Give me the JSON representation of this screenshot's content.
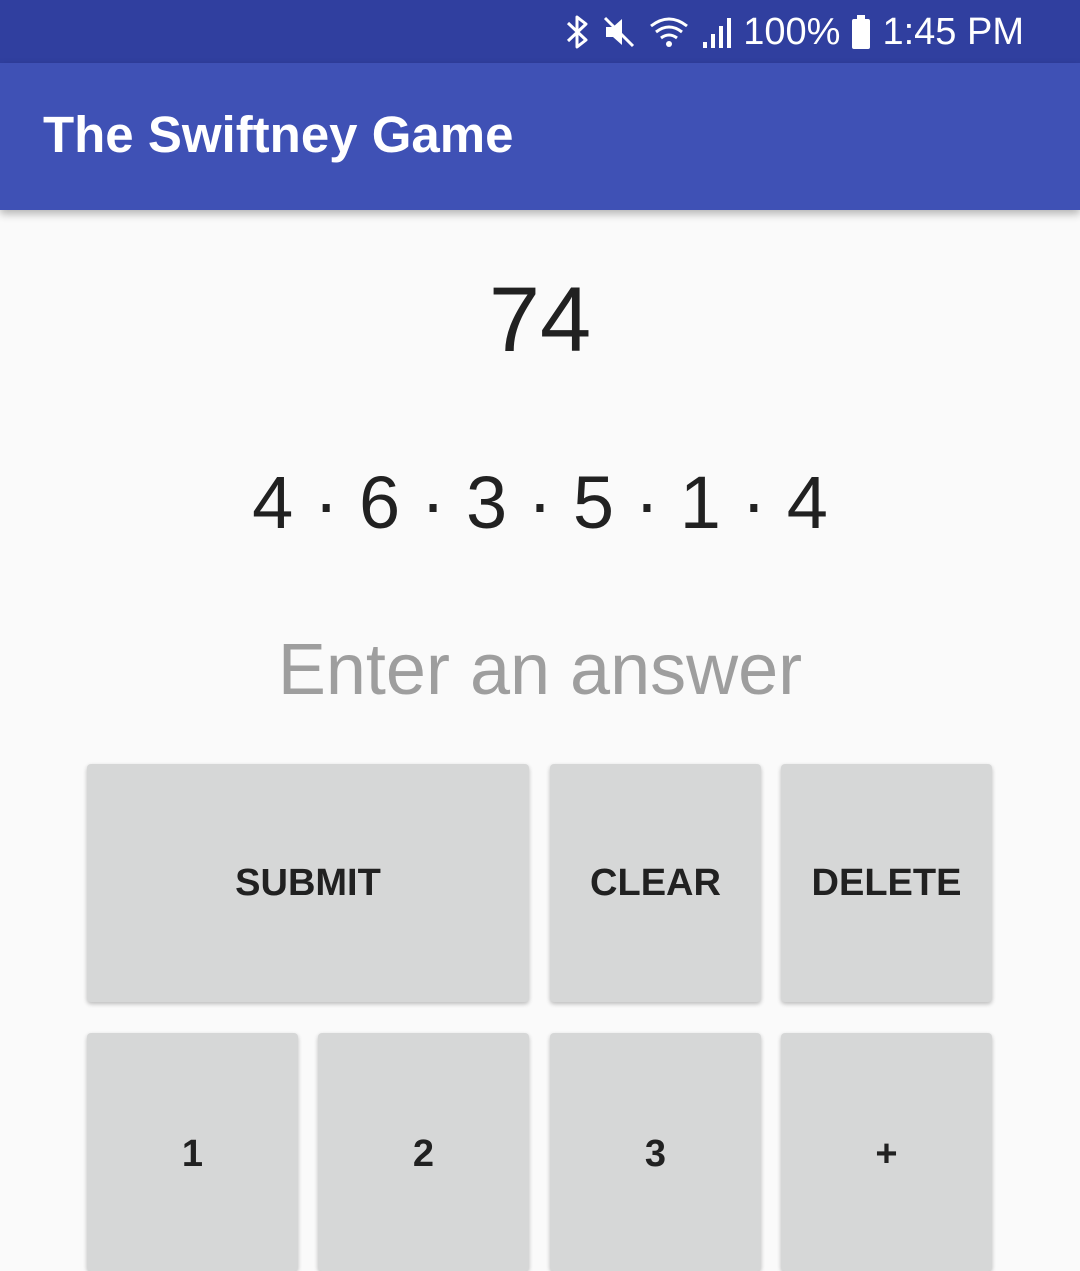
{
  "status_bar": {
    "battery_percent": "100%",
    "time": "1:45 PM",
    "icons": [
      "bluetooth-icon",
      "mute-icon",
      "wifi-icon",
      "signal-icon",
      "battery-icon"
    ],
    "background_color": "#303f9f"
  },
  "app_bar": {
    "title": "The Swiftney Game",
    "background_color": "#3f51b5"
  },
  "game": {
    "target": "74",
    "digits": "4 · 6 · 3 · 5 · 1 · 4"
  },
  "answer": {
    "value": "",
    "placeholder": "Enter an answer"
  },
  "buttons": {
    "submit": "SUBMIT",
    "clear": "CLEAR",
    "delete": "DELETE",
    "one": "1",
    "two": "2",
    "three": "3",
    "plus": "+",
    "background_color": "#d6d7d7"
  }
}
